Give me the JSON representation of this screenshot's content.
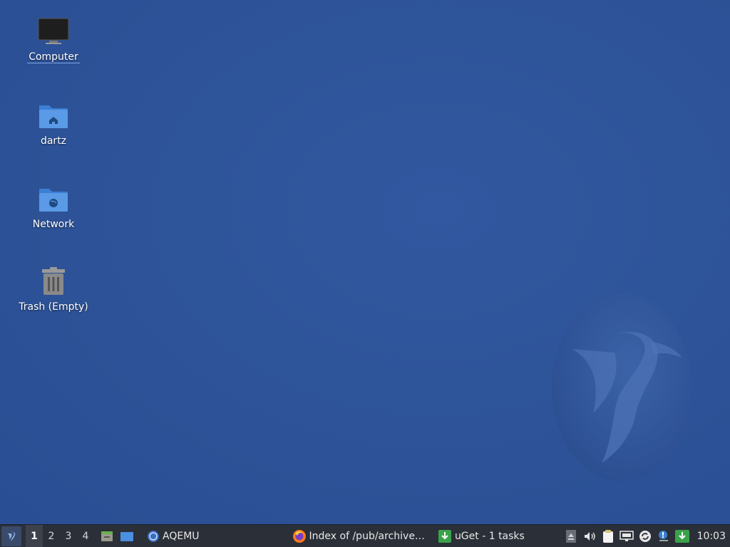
{
  "desktop": {
    "icons": [
      {
        "name": "computer",
        "label": "Computer"
      },
      {
        "name": "home",
        "label": "dartz"
      },
      {
        "name": "network",
        "label": "Network"
      },
      {
        "name": "trash",
        "label": "Trash (Empty)"
      }
    ]
  },
  "taskbar": {
    "workspaces": [
      "1",
      "2",
      "3",
      "4"
    ],
    "active_workspace": "1",
    "tasks": [
      {
        "label": "AQEMU",
        "icon": "aqemu-icon"
      },
      {
        "label": "Index of /pub/archive…",
        "icon": "firefox-icon"
      },
      {
        "label": "uGet - 1 tasks",
        "icon": "uget-icon"
      }
    ],
    "tray_icons": [
      "eject-icon",
      "volume-icon",
      "clipboard-icon",
      "network-wired-icon",
      "update-icon",
      "notification-icon",
      "uget-tray-icon"
    ],
    "clock": "10:03"
  },
  "colors": {
    "desktop_bg": "#2e5399",
    "panel_bg": "#2b2f38",
    "folder_blue": "#4a90e2"
  }
}
